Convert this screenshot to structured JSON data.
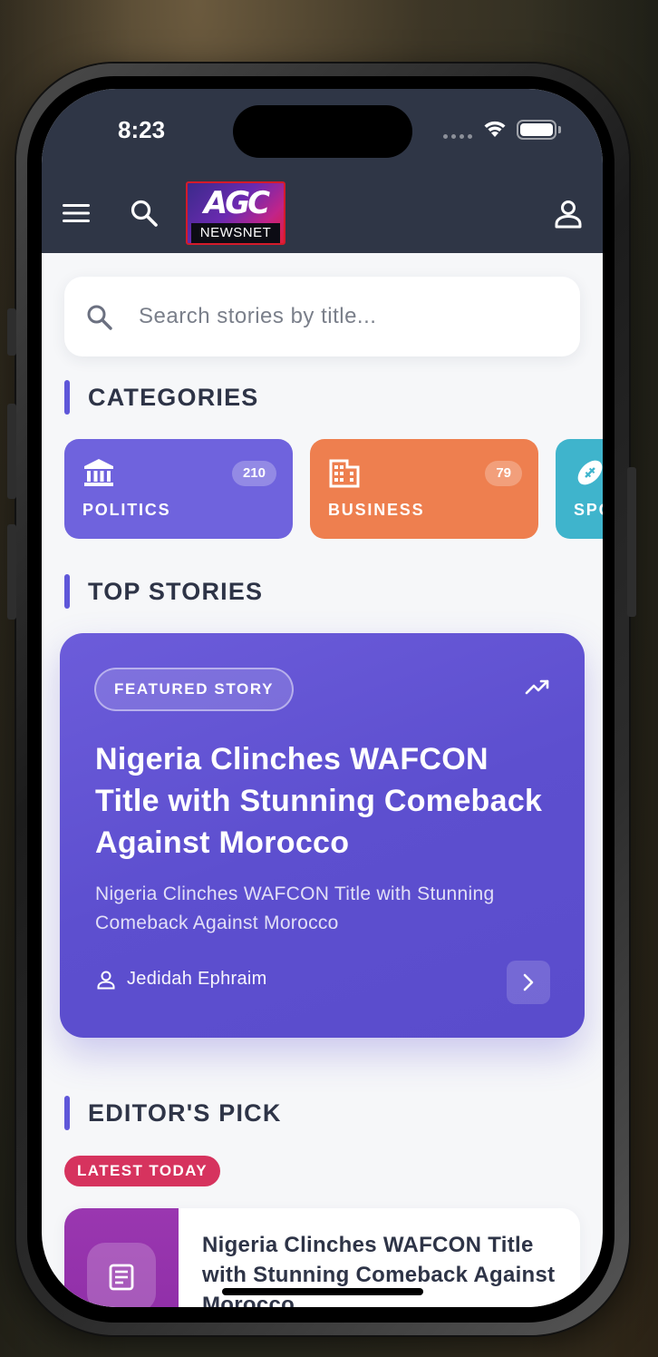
{
  "status_bar": {
    "time": "8:23"
  },
  "header": {
    "logo_mark": "AGC",
    "logo_sub": "NEWSNET"
  },
  "search": {
    "placeholder": "Search stories by title..."
  },
  "sections": {
    "categories": "CATEGORIES",
    "top_stories": "TOP STORIES",
    "editors_pick": "EDITOR'S PICK"
  },
  "categories": [
    {
      "name": "POLITICS",
      "count": "210",
      "icon": "bank-icon",
      "color": "#6f63dd"
    },
    {
      "name": "BUSINESS",
      "count": "79",
      "icon": "building-icon",
      "color": "#ee7f4f"
    },
    {
      "name": "SPO",
      "count": "",
      "icon": "football-icon",
      "color": "#3fb4cc"
    }
  ],
  "featured": {
    "badge": "FEATURED STORY",
    "title": "Nigeria Clinches WAFCON Title with Stunning Comeback Against Morocco",
    "description": "Nigeria Clinches WAFCON Title with Stunning Comeback Against Morocco",
    "author": "Jedidah Ephraim"
  },
  "editors_pick": {
    "badge": "LATEST TODAY",
    "items": [
      {
        "title": "Nigeria Clinches WAFCON Title with Stunning Comeback Against Morocco",
        "icon": "article-icon"
      }
    ]
  },
  "colors": {
    "header_bg": "#2f3646",
    "accent": "#5f57d9",
    "featured_bg": "#5d4fcf",
    "latest_badge": "#d6335e"
  }
}
